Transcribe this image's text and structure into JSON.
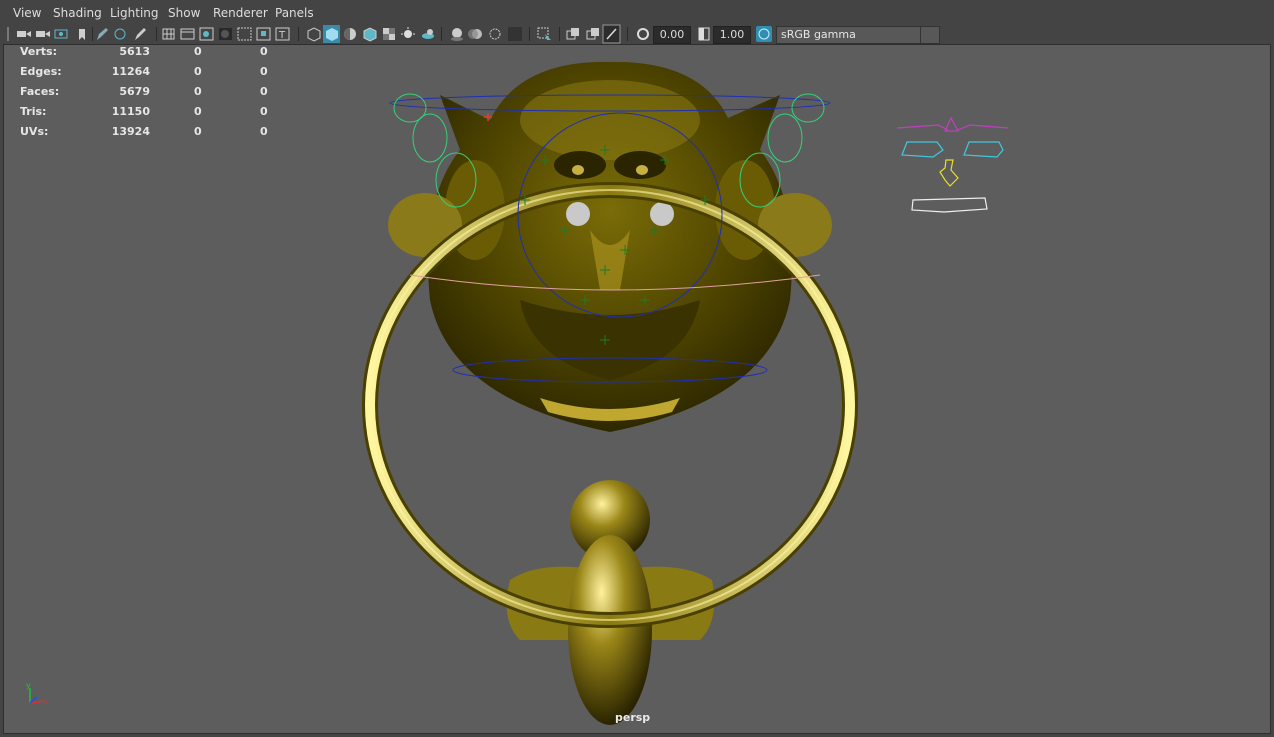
{
  "menu": {
    "items": [
      "View",
      "Shading",
      "Lighting",
      "Show",
      "Renderer",
      "Panels"
    ]
  },
  "toolbar": {
    "exposure": "0.00",
    "gamma": "1.00",
    "color_management": "sRGB gamma",
    "icons": [
      "camera-icon",
      "camera-attributes-icon",
      "bookmark-icon",
      "image-plane-icon",
      "grid-icon",
      "film-gate-icon",
      "resolution-gate-icon",
      "gate-mask-icon",
      "field-chart-icon",
      "safe-action-icon",
      "safe-title-icon",
      "wireframe-icon",
      "smooth-shade-icon",
      "default-material-icon",
      "wireframe-on-shaded-icon",
      "xray-icon",
      "textured-icon",
      "use-all-lights-icon",
      "shadows-icon",
      "screen-space-ao-icon",
      "motion-blur-icon",
      "anti-aliasing-icon",
      "depth-of-field-icon",
      "isolate-select-icon",
      "xray-joints-icon",
      "xray-active-icon",
      "exposure-icon",
      "gamma-icon",
      "color-management-icon"
    ]
  },
  "hud": {
    "rows": [
      {
        "label": "Verts:",
        "v1": "5613",
        "v2": "0",
        "v3": "0"
      },
      {
        "label": "Edges:",
        "v1": "11264",
        "v2": "0",
        "v3": "0"
      },
      {
        "label": "Faces:",
        "v1": "5679",
        "v2": "0",
        "v3": "0"
      },
      {
        "label": "Tris:",
        "v1": "11150",
        "v2": "0",
        "v3": "0"
      },
      {
        "label": "UVs:",
        "v1": "13924",
        "v2": "0",
        "v3": "0"
      }
    ]
  },
  "viewport": {
    "camera": "persp",
    "axis_y": "y",
    "axis_x": "x"
  },
  "colors": {
    "gold": "#6b5e00",
    "gold_highlight": "#f4e36a",
    "wire_blue": "#1a2a9a",
    "wire_green": "#35d07a",
    "face_magenta": "#c040c0",
    "face_cyan": "#40c8e0",
    "face_yellow": "#e8e020"
  }
}
